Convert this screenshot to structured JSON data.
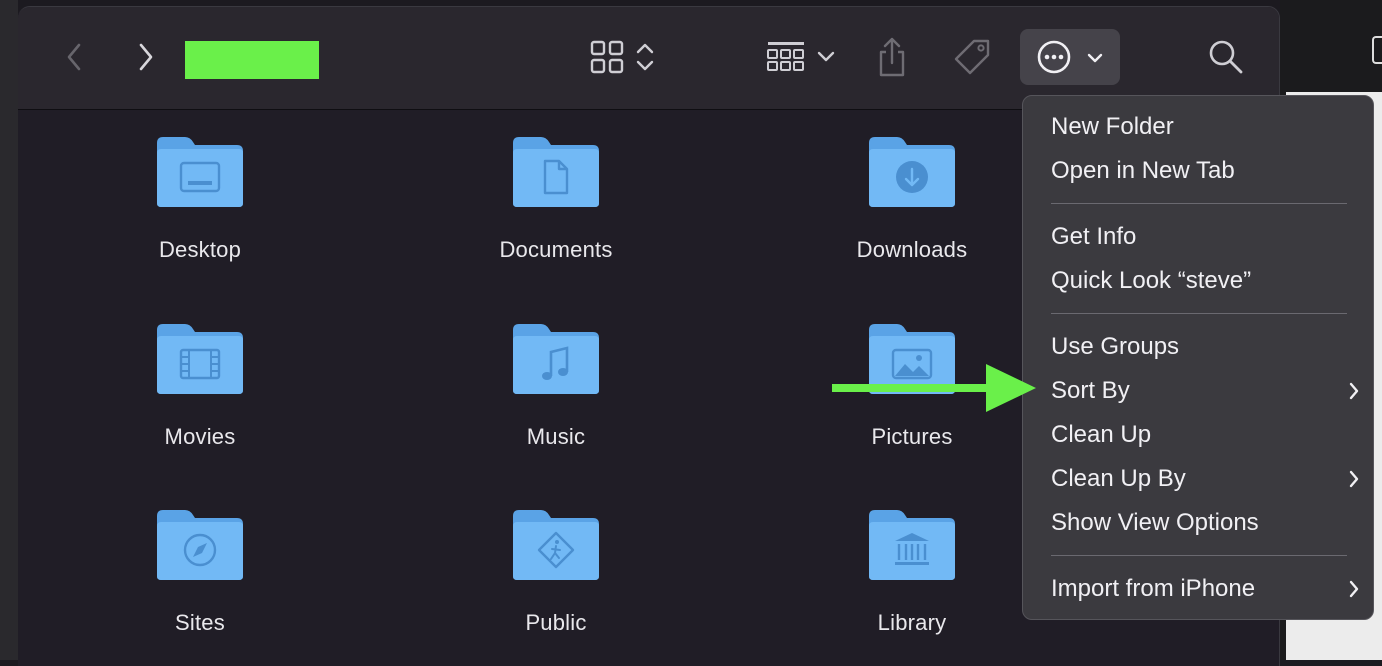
{
  "toolbar": {
    "back_icon": "chevron-left-icon",
    "forward_icon": "chevron-right-icon",
    "title_redaction_color": "#6af04a",
    "view_icon": "grid-view-icon",
    "group_icon": "group-by-icon",
    "share_icon": "share-icon",
    "tag_icon": "tag-icon",
    "more_icon": "ellipsis-circle-icon",
    "search_icon": "search-icon"
  },
  "folders": [
    {
      "label": "Desktop",
      "icon": "desktop-folder-icon"
    },
    {
      "label": "Documents",
      "icon": "documents-folder-icon"
    },
    {
      "label": "Downloads",
      "icon": "downloads-folder-icon"
    },
    {
      "label": "Movies",
      "icon": "movies-folder-icon"
    },
    {
      "label": "Music",
      "icon": "music-folder-icon"
    },
    {
      "label": "Pictures",
      "icon": "pictures-folder-icon"
    },
    {
      "label": "Sites",
      "icon": "sites-folder-icon"
    },
    {
      "label": "Public",
      "icon": "public-folder-icon"
    },
    {
      "label": "Library",
      "icon": "library-folder-icon"
    }
  ],
  "menu": {
    "items": [
      {
        "label": "New Folder",
        "submenu": false
      },
      {
        "label": "Open in New Tab",
        "submenu": false
      },
      {
        "label": "Get Info",
        "submenu": false
      },
      {
        "label": "Quick Look “steve”",
        "submenu": false
      },
      {
        "label": "Use Groups",
        "submenu": false
      },
      {
        "label": "Sort By",
        "submenu": true
      },
      {
        "label": "Clean Up",
        "submenu": false
      },
      {
        "label": "Clean Up By",
        "submenu": true
      },
      {
        "label": "Show View Options",
        "submenu": false
      },
      {
        "label": "Import from iPhone",
        "submenu": true
      }
    ]
  },
  "annotation": {
    "arrow_color": "#6af04a",
    "arrow_target": "Sort By"
  },
  "colors": {
    "folder": "#6cb4f0",
    "folder_glyph": "#4a8fd0"
  }
}
